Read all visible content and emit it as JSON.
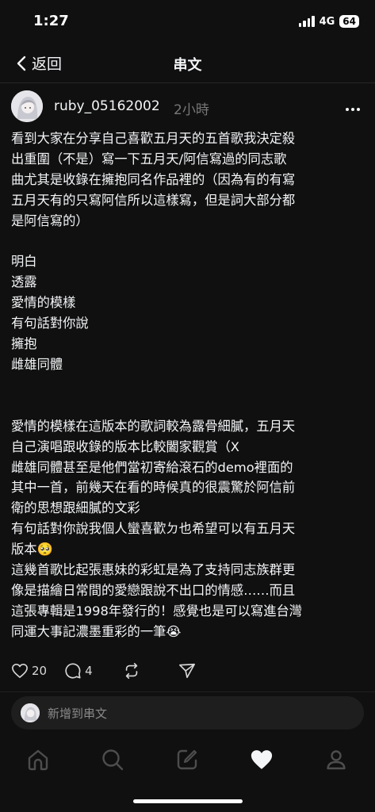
{
  "status_bar": {
    "time": "1:27",
    "network": "4G",
    "battery": "64"
  },
  "nav": {
    "back_label": "返回",
    "title": "串文"
  },
  "post": {
    "username": "ruby_05162002",
    "time": "2小時",
    "body": "看到大家在分享自己喜歡五月天的五首歌我決定殺\n出重圍（不是）寫一下五月天/阿信寫過的同志歌\n曲尤其是收錄在擁抱同名作品裡的（因為有的有寫\n五月天有的只寫阿信所以這樣寫，但是詞大部分都\n是阿信寫的）\n\n明白\n透露\n愛情的模樣\n有句話對你說\n擁抱\n雌雄同體\n\n\n愛情的模樣在這版本的歌詞較為露骨細膩，五月天\n自己演唱跟收錄的版本比較闔家觀賞（X\n雌雄同體甚至是他們當初寄給滾石的demo裡面的\n其中一首，前幾天在看的時候真的很震驚於阿信前\n衛的思想跟細膩的文彩\n有句話對你說我個人蠻喜歡ㄉ也希望可以有五月天\n版本🥺\n這幾首歌比起張惠妹的彩虹是為了支持同志族群更\n像是描繪日常間的愛戀跟說不出口的情感……而且\n這張專輯是1998年發行的！感覺也是可以寫進台灣\n同運大事記濃墨重彩的一筆😭",
    "likes": "20",
    "comments": "4"
  },
  "reply_bar": {
    "placeholder": "新增到串文"
  },
  "icons": {
    "back": "chevron-left-icon",
    "more": "more-icon",
    "like": "heart-icon",
    "comment": "comment-icon",
    "repost": "repost-icon",
    "share": "send-icon",
    "tab_home": "home-icon",
    "tab_search": "search-icon",
    "tab_compose": "compose-icon",
    "tab_activity": "heart-filled-icon",
    "tab_profile": "profile-icon"
  },
  "colors": {
    "background": "#101010",
    "text": "#f3f5f7",
    "muted": "#777777"
  }
}
